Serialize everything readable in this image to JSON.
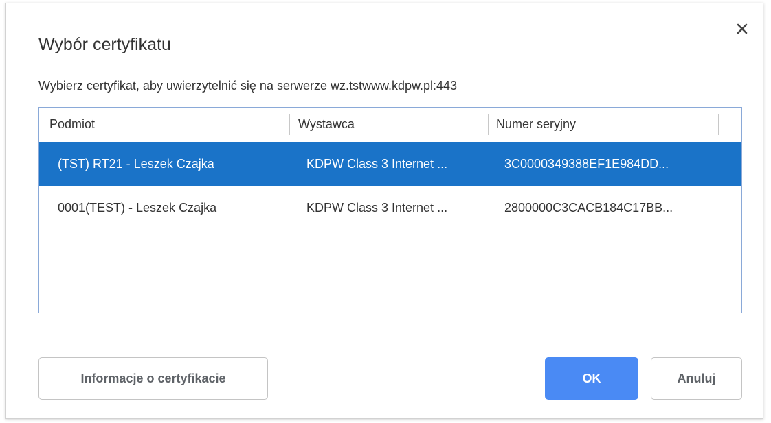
{
  "dialog": {
    "title": "Wybór certyfikatu",
    "subtitle": "Wybierz certyfikat, aby uwierzytelnić się na serwerze wz.tstwww.kdpw.pl:443",
    "close_icon": "close-icon"
  },
  "table": {
    "columns": [
      "Podmiot",
      "Wystawca",
      "Numer seryjny"
    ],
    "rows": [
      {
        "subject": "(TST) RT21 - Leszek Czajka",
        "issuer": "KDPW Class 3 Internet ...",
        "serial": "3C0000349388EF1E984DD...",
        "selected": true
      },
      {
        "subject": "0001(TEST) - Leszek Czajka",
        "issuer": "KDPW Class 3 Internet ...",
        "serial": "2800000C3CACB184C17BB...",
        "selected": false
      }
    ]
  },
  "buttons": {
    "info_label": "Informacje o certyfikacie",
    "ok_label": "OK",
    "cancel_label": "Anuluj"
  },
  "colors": {
    "selection": "#1a73c8",
    "primary_button": "#4a8af4",
    "table_border": "#8aa9d8"
  }
}
